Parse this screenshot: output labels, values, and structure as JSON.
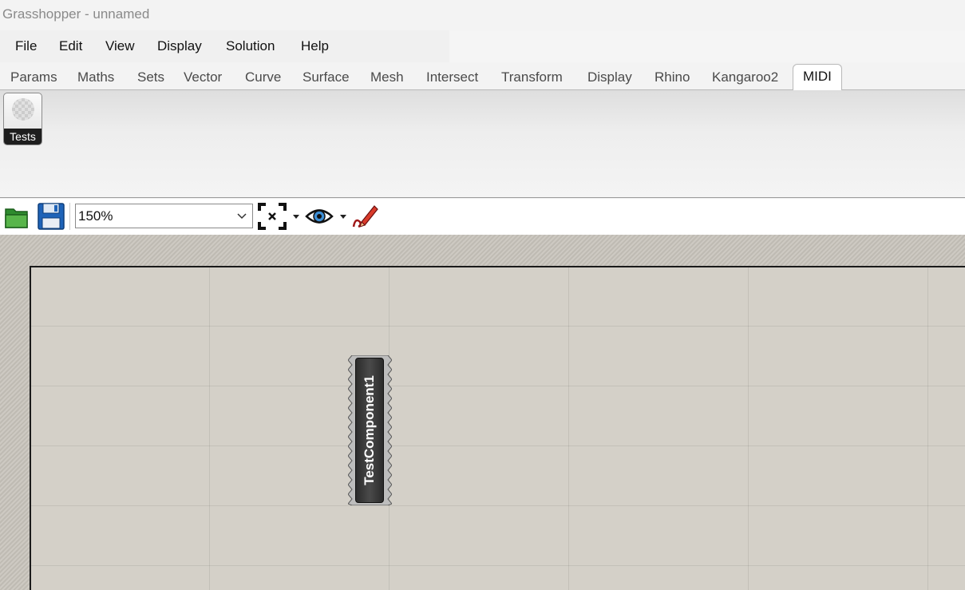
{
  "window": {
    "title": "Grasshopper - unnamed"
  },
  "menu": [
    "File",
    "Edit",
    "View",
    "Display",
    "Solution",
    "Help"
  ],
  "tabs": [
    "Params",
    "Maths",
    "Sets",
    "Vector",
    "Curve",
    "Surface",
    "Mesh",
    "Intersect",
    "Transform",
    "Display",
    "Rhino",
    "Kangaroo2",
    "MIDI"
  ],
  "active_tab": "MIDI",
  "ribbon": {
    "group_label": "Tests"
  },
  "toolbar": {
    "zoom_value": "150%",
    "icons": [
      "open-file-icon",
      "save-icon",
      "zoom-extents-icon",
      "preview-eye-icon",
      "sketch-pen-icon"
    ]
  },
  "canvas": {
    "components": [
      {
        "label": "TestComponent1"
      }
    ]
  },
  "colors": {
    "canvas_bg": "#d4d0c8",
    "component_body": "#3a3a3a",
    "ribbon_label_bg": "#1e1e1e"
  }
}
